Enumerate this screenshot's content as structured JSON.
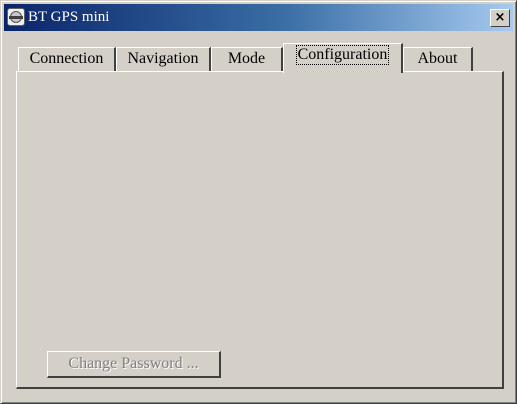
{
  "window": {
    "title": "BT GPS mini",
    "close_glyph": "×",
    "icon": "app-icon"
  },
  "tabs": [
    {
      "label": "Connection",
      "active": false
    },
    {
      "label": "Navigation",
      "active": false
    },
    {
      "label": "Mode",
      "active": false
    },
    {
      "label": "Configuration",
      "active": true
    },
    {
      "label": "About",
      "active": false
    }
  ],
  "panel": {
    "change_password_label": "Change Password ...",
    "change_password_enabled": false
  }
}
